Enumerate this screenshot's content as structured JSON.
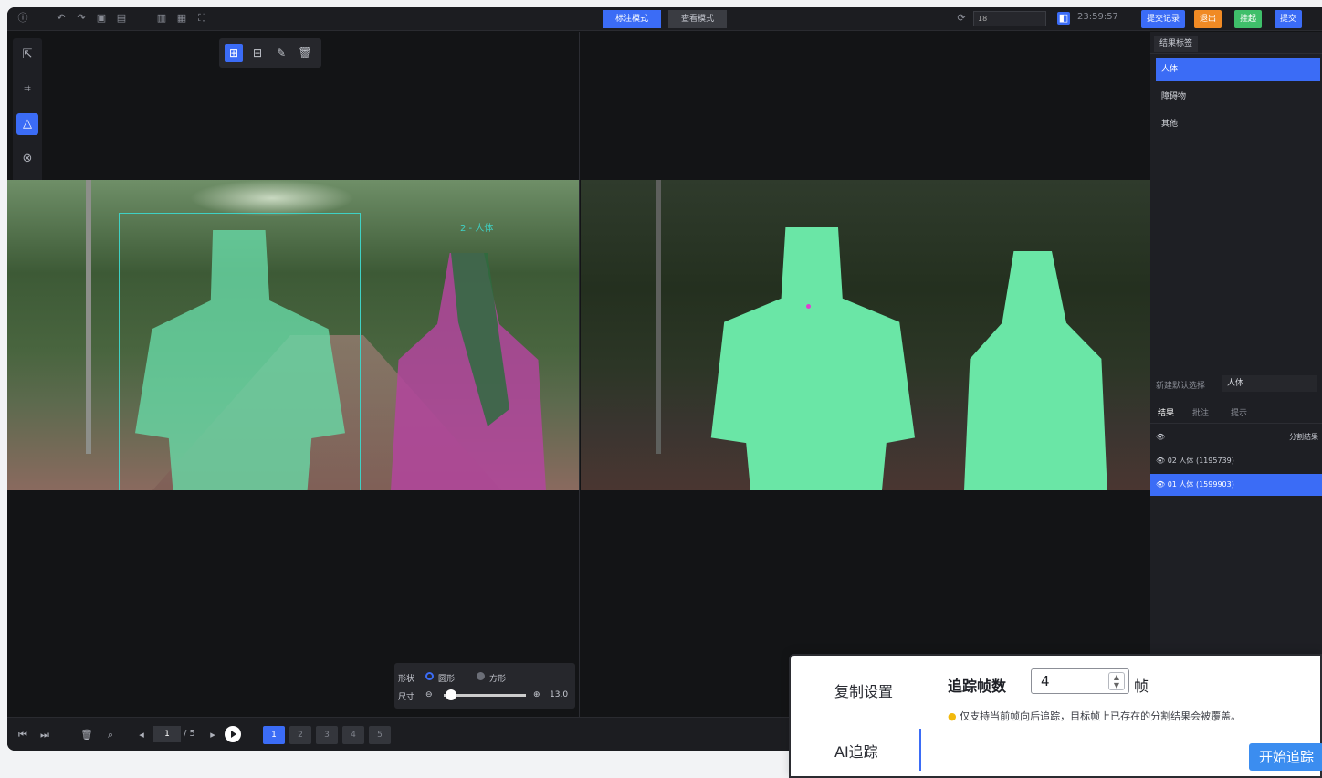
{
  "topbar": {
    "modes": [
      "标注模式",
      "查看模式"
    ],
    "frame_value": "18",
    "time": "23:59:57",
    "buttons": [
      {
        "label": "提交记录",
        "color": "#3b6cf6"
      },
      {
        "label": "退出",
        "color": "#f08a24"
      },
      {
        "label": "挂起",
        "color": "#3fbf6a"
      },
      {
        "label": "提交",
        "color": "#3b6cf6"
      }
    ]
  },
  "viewer": {
    "box_label": "2 - 人体"
  },
  "brush_panel": {
    "shape_label": "形状",
    "shape_options": [
      "圆形",
      "方形"
    ],
    "size_label": "尺寸",
    "size_value": "13.0"
  },
  "navigator": {
    "current_page": "1",
    "total_pages": "/ 5",
    "frames": [
      "1",
      "2",
      "3",
      "4",
      "5"
    ]
  },
  "right_panel": {
    "tab_label": "结果标签",
    "labels": [
      "人体",
      "障碍物",
      "其他"
    ],
    "default_select_label": "新建默认选择",
    "default_select_value": "人体",
    "result_tabs": [
      "结果",
      "批注",
      "提示"
    ],
    "result_header_right": "分割结果",
    "results": [
      {
        "text": "02 人体 (1195739)"
      },
      {
        "text": "01 人体 (1599903)"
      }
    ]
  },
  "popup": {
    "menu": [
      "复制设置",
      "AI追踪"
    ],
    "title": "追踪帧数",
    "frame_count": "4",
    "unit": "帧",
    "hint": "仅支持当前帧向后追踪，目标帧上已存在的分割结果会被覆盖。",
    "start_button": "开始追踪"
  }
}
